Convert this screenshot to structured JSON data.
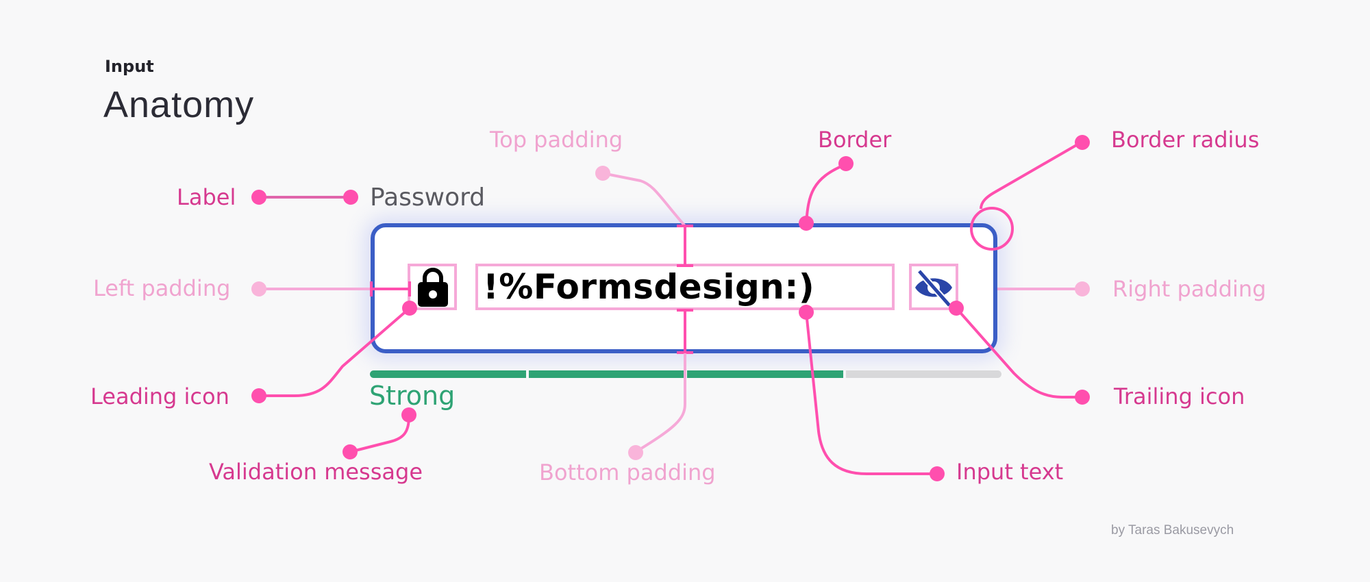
{
  "header": {
    "eyebrow": "Input",
    "title": "Anatomy"
  },
  "field": {
    "label": "Password",
    "value": "!%Formsdesign:)",
    "leading_icon": "lock-icon",
    "trailing_icon": "eye-off-icon",
    "strength": {
      "filled_segments": 3,
      "total_segments": 4,
      "level": "Strong"
    },
    "validation_message": "Strong"
  },
  "annotations": {
    "label": "Label",
    "left_padding": "Left padding",
    "leading_icon": "Leading icon",
    "validation_message": "Validation message",
    "top_padding": "Top padding",
    "bottom_padding": "Bottom padding",
    "border": "Border",
    "border_radius": "Border radius",
    "right_padding": "Right padding",
    "trailing_icon": "Trailing icon",
    "input_text": "Input text"
  },
  "credit": "by Taras Bakusevych",
  "colors": {
    "background": "#f8f8f9",
    "accent_annotation": "#ff4fae",
    "annotation_text": "#d6398f",
    "soft_annotation": "#f6a9d8",
    "border_blue": "#3b5ec6",
    "success_green": "#2ea374",
    "track_gray": "#d8d8da",
    "eye_icon_blue": "#2a45a8"
  }
}
